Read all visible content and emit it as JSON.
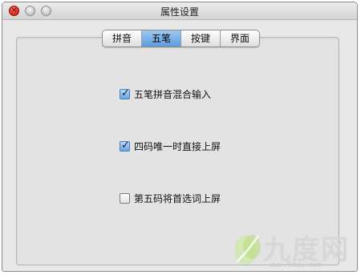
{
  "window": {
    "title": "属性设置"
  },
  "tabs": [
    {
      "label": "拼音",
      "selected": false
    },
    {
      "label": "五笔",
      "selected": true
    },
    {
      "label": "按键",
      "selected": false
    },
    {
      "label": "界面",
      "selected": false
    }
  ],
  "options": [
    {
      "label": "五笔拼音混合输入",
      "checked": true
    },
    {
      "label": "四码唯一时直接上屏",
      "checked": true
    },
    {
      "label": "第五码将首选词上屏",
      "checked": false
    }
  ],
  "watermark": {
    "brand": "九度网",
    "url": "www.9duw.com"
  },
  "colors": {
    "selected_tab": "#6aa6e2",
    "close_button": "#e63a2a"
  }
}
